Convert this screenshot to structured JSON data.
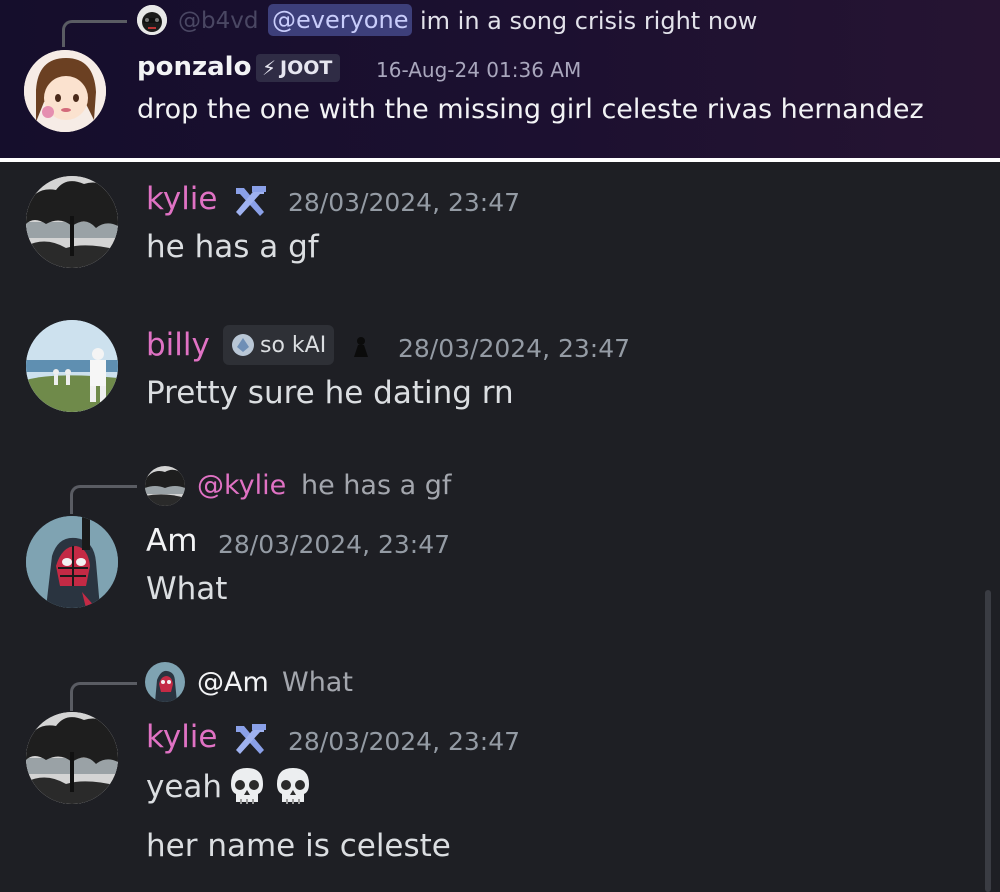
{
  "header_message": {
    "reply": {
      "author_faded": "@b4vd",
      "mention": "@everyone",
      "text": "im in a song crisis right now"
    },
    "author": "ponzalo",
    "tag": "JOOT",
    "timestamp": "16-Aug-24 01:36 AM",
    "text": "drop the one with the missing girl celeste rivas hernandez"
  },
  "messages": [
    {
      "author": "kylie",
      "timestamp": "28/03/2024, 23:47",
      "lines": [
        "he has a gf"
      ]
    },
    {
      "author": "billy",
      "role_tag": "so kAI",
      "timestamp": "28/03/2024, 23:47",
      "lines": [
        "Pretty sure he dating rn"
      ]
    },
    {
      "reply": {
        "author": "@kylie",
        "text": "he has a gf"
      },
      "author": "Am",
      "timestamp": "28/03/2024, 23:47",
      "lines": [
        "What"
      ]
    },
    {
      "reply": {
        "author": "@Am",
        "text": "What"
      },
      "author": "kylie",
      "timestamp": "28/03/2024, 23:47",
      "lines": [
        "yeah",
        "her name is celeste"
      ]
    }
  ],
  "colors": {
    "kylie_name": "#e072c4",
    "billy_name": "#e072c4",
    "am_name": "#f2f3f5",
    "background": "#1e1f24",
    "timestamp": "#949ba4",
    "header_bg": "#1c1030"
  },
  "icons": [
    "skull-emoji",
    "hammer-pick-icon",
    "bolt-icon",
    "gem-icon"
  ]
}
